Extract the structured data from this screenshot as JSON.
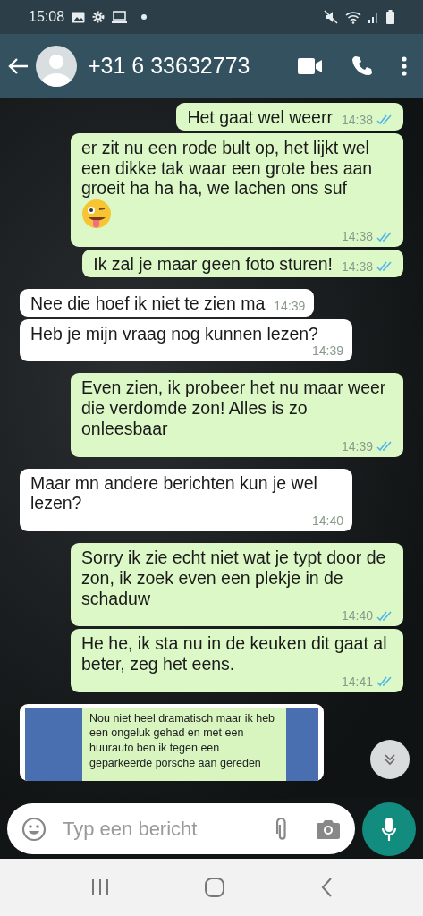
{
  "status_bar": {
    "time": "15:08"
  },
  "header": {
    "title": "+31 6 33632773"
  },
  "messages": [
    {
      "kind": "out",
      "text": "Het gaat wel weerr",
      "time": "14:38",
      "read": true
    },
    {
      "kind": "out",
      "text": "er zit nu een rode bult op, het lijkt wel een dikke tak waar een grote bes aan groeit ha ha ha, we lachen ons suf",
      "emoji": true,
      "time": "14:38",
      "read": true
    },
    {
      "kind": "out",
      "text": "Ik zal je maar geen foto sturen!",
      "time": "14:38",
      "read": true
    },
    {
      "kind": "in",
      "text": "Nee die hoef ik niet te zien ma",
      "time": "14:39"
    },
    {
      "kind": "in",
      "text": "Heb je mijn vraag nog kunnen lezen?",
      "time": "14:39"
    },
    {
      "kind": "out",
      "text": "Even zien, ik probeer het nu maar weer die verdomde zon! Alles is zo onleesbaar",
      "time": "14:39",
      "read": true
    },
    {
      "kind": "in",
      "text": "Maar mn andere berichten kun je wel lezen?",
      "time": "14:40"
    },
    {
      "kind": "out",
      "text": "Sorry ik zie echt niet wat je typt door de zon, ik zoek even een plekje in de schaduw",
      "time": "14:40",
      "read": true
    },
    {
      "kind": "out",
      "text": "He he, ik sta nu in de keuken dit gaat al beter, zeg het eens.",
      "time": "14:41",
      "read": true
    },
    {
      "kind": "image",
      "text": "Nou niet heel dramatisch maar ik heb een ongeluk gehad en met een huurauto ben ik tegen een geparkeerde porsche aan gereden"
    }
  ],
  "composer": {
    "placeholder": "Typ een bericht"
  }
}
